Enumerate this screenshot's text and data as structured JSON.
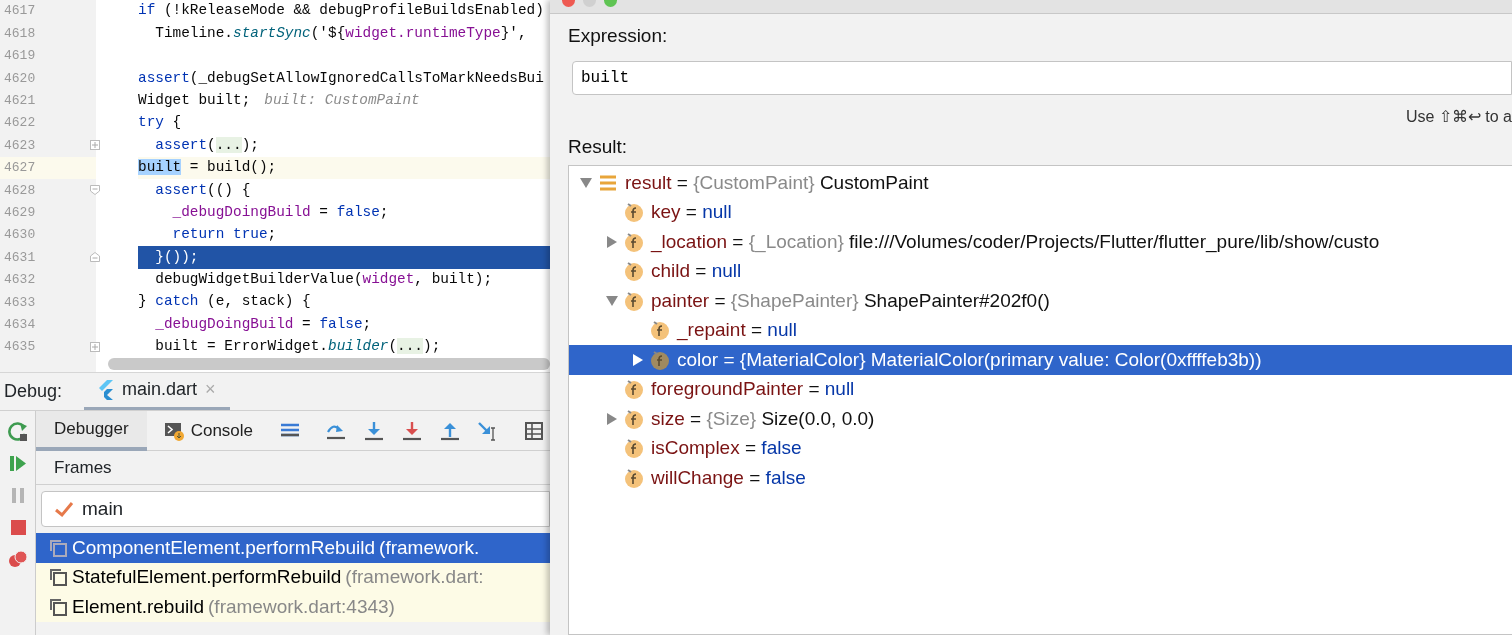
{
  "editor": {
    "lines": [
      {
        "number": "4617",
        "kind": "plain",
        "tokens": [
          {
            "kind": "kw",
            "text": "if"
          },
          {
            "kind": "plain",
            "text": " (!kReleaseMode && debugProfileBuildsEnabled)"
          }
        ]
      },
      {
        "number": "4618",
        "kind": "plain",
        "tokens": [
          {
            "kind": "plain",
            "text": "  Timeline."
          },
          {
            "kind": "fn",
            "text": "startSync"
          },
          {
            "kind": "plain",
            "text": "('${"
          },
          {
            "kind": "field",
            "text": "widget.runtimeType"
          },
          {
            "kind": "plain",
            "text": "}',"
          }
        ]
      },
      {
        "number": "4619",
        "kind": "plain"
      },
      {
        "number": "4620",
        "kind": "plain",
        "tokens": [
          {
            "kind": "kw",
            "text": "assert"
          },
          {
            "kind": "plain",
            "text": "(_debugSetAllowIgnoredCallsToMarkNeedsBui"
          }
        ]
      },
      {
        "number": "4621",
        "kind": "plain",
        "tokens": [
          {
            "kind": "plain",
            "text": "Widget built;"
          },
          {
            "kind": "hint",
            "text": "built: CustomPaint"
          }
        ]
      },
      {
        "number": "4622",
        "kind": "plain",
        "tokens": [
          {
            "kind": "kw",
            "text": "try"
          },
          {
            "kind": "plain",
            "text": " {"
          }
        ]
      },
      {
        "number": "4623",
        "kind": "folded",
        "tokens": [
          {
            "kind": "kw",
            "text": "  assert"
          },
          {
            "kind": "plain",
            "text": "("
          },
          {
            "kind": "folded",
            "text": "..."
          },
          {
            "kind": "plain",
            "text": ");"
          }
        ]
      },
      {
        "number": "4627",
        "kind": "plain",
        "current": true,
        "tokens": [
          {
            "kind": "match",
            "text": "built"
          },
          {
            "kind": "plain",
            "text": " = build();"
          }
        ]
      },
      {
        "number": "4628",
        "kind": "fold_start",
        "tokens": [
          {
            "kind": "kw",
            "text": "  assert"
          },
          {
            "kind": "plain",
            "text": "(() {"
          }
        ]
      },
      {
        "number": "4629",
        "kind": "plain",
        "tokens": [
          {
            "kind": "field",
            "text": "    _debugDoingBuild"
          },
          {
            "kind": "plain",
            "text": " = "
          },
          {
            "kind": "kw",
            "text": "false"
          },
          {
            "kind": "plain",
            "text": ";"
          }
        ]
      },
      {
        "number": "4630",
        "kind": "plain",
        "tokens": [
          {
            "kind": "kw",
            "text": "    return true"
          },
          {
            "kind": "plain",
            "text": ";"
          }
        ]
      },
      {
        "number": "4631",
        "kind": "fold_end",
        "selected": true,
        "tokens": [
          {
            "kind": "plain",
            "text": "  }());"
          }
        ]
      },
      {
        "number": "4632",
        "kind": "plain",
        "tokens": [
          {
            "kind": "plain",
            "text": "  debugWidgetBuilderValue("
          },
          {
            "kind": "field",
            "text": "widget"
          },
          {
            "kind": "plain",
            "text": ", built);"
          }
        ]
      },
      {
        "number": "4633",
        "kind": "plain",
        "tokens": [
          {
            "kind": "plain",
            "text": "} "
          },
          {
            "kind": "kw",
            "text": "catch"
          },
          {
            "kind": "plain",
            "text": " (e, stack) {"
          }
        ]
      },
      {
        "number": "4634",
        "kind": "plain",
        "tokens": [
          {
            "kind": "field",
            "text": "  _debugDoingBuild"
          },
          {
            "kind": "plain",
            "text": " = "
          },
          {
            "kind": "kw",
            "text": "false"
          },
          {
            "kind": "plain",
            "text": ";"
          }
        ]
      },
      {
        "number": "4635",
        "kind": "folded",
        "tokens": [
          {
            "kind": "plain",
            "text": "  built = ErrorWidget."
          },
          {
            "kind": "fn",
            "text": "builder"
          },
          {
            "kind": "plain",
            "text": "("
          },
          {
            "kind": "folded",
            "text": "..."
          },
          {
            "kind": "plain",
            "text": ");"
          }
        ]
      }
    ]
  },
  "debug": {
    "label": "Debug:",
    "session_tab": {
      "label": "main.dart",
      "close": "×"
    },
    "tabs": [
      {
        "label": "Debugger",
        "selected": true
      },
      {
        "label": "Console",
        "selected": false
      }
    ],
    "frames": {
      "title": "Frames",
      "thread": "main",
      "rows": [
        {
          "name": "ComponentElement.performRebuild",
          "location": "(framework.",
          "selected": true
        },
        {
          "name": "StatefulElement.performRebuild",
          "location": "(framework.dart:",
          "selected": false
        },
        {
          "name": "Element.rebuild",
          "location": "(framework.dart:4343)",
          "selected": false
        }
      ]
    }
  },
  "evaluate": {
    "expression_label": "Expression:",
    "expression": "built",
    "hint": "Use ⇧⌘↩ to a",
    "result_label": "Result:",
    "tree": [
      {
        "kind": "result",
        "name": "result",
        "op": "=",
        "type": "{CustomPaint}",
        "value": "CustomPaint",
        "literal": false,
        "expanded": true,
        "selected": false,
        "children": [
          {
            "kind": "field",
            "name": "key",
            "op": "=",
            "value": "null",
            "literal": true,
            "selected": false
          },
          {
            "kind": "field",
            "name": "_location",
            "op": "=",
            "type": "{_Location}",
            "value": "file:///Volumes/coder/Projects/Flutter/flutter_pure/lib/show/custo",
            "literal": false,
            "expanded": false,
            "selected": false
          },
          {
            "kind": "field",
            "name": "child",
            "op": "=",
            "value": "null",
            "literal": true,
            "selected": false
          },
          {
            "kind": "field",
            "name": "painter",
            "op": "=",
            "type": "{ShapePainter}",
            "value": "ShapePainter#202f0()",
            "literal": false,
            "expanded": true,
            "selected": false,
            "children": [
              {
                "kind": "field",
                "name": "_repaint",
                "op": "=",
                "value": "null",
                "literal": true,
                "selected": false
              },
              {
                "kind": "field",
                "name": "color",
                "op": "=",
                "type": "{MaterialColor}",
                "value": "MaterialColor(primary value: Color(0xffffeb3b))",
                "literal": false,
                "expanded": false,
                "selected": true
              }
            ]
          },
          {
            "kind": "field",
            "name": "foregroundPainter",
            "op": "=",
            "value": "null",
            "literal": true,
            "selected": false
          },
          {
            "kind": "field",
            "name": "size",
            "op": "=",
            "type": "{Size}",
            "value": "Size(0.0, 0.0)",
            "literal": false,
            "expanded": false,
            "selected": false
          },
          {
            "kind": "field",
            "name": "isComplex",
            "op": "=",
            "value": "false",
            "literal": true,
            "selected": false
          },
          {
            "kind": "field",
            "name": "willChange",
            "op": "=",
            "value": "false",
            "literal": true,
            "selected": false
          }
        ]
      }
    ]
  }
}
